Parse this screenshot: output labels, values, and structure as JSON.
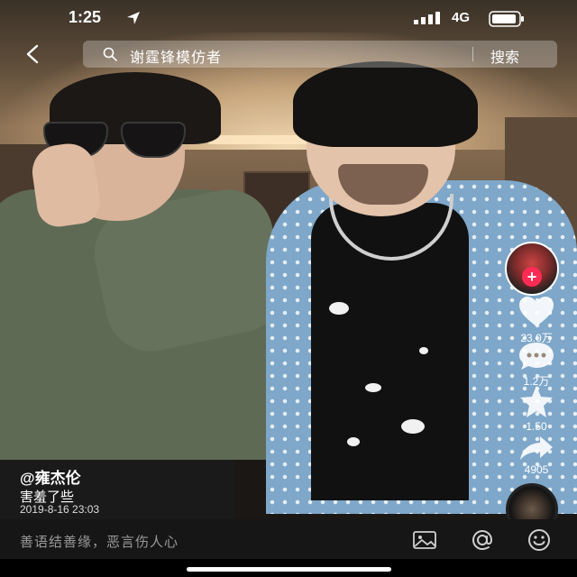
{
  "status_bar": {
    "time": "1:25",
    "network": "4G"
  },
  "header": {
    "search_query": "谢霆锋模仿者",
    "search_button": "搜索"
  },
  "actions": {
    "likes": "23.0万",
    "comments": "1.2万",
    "favorites": "1.50",
    "shares": "4905",
    "follow_symbol": "+"
  },
  "video": {
    "author": "@雍杰伦",
    "caption": "害羞了些",
    "date": "2019-8-16 23:03"
  },
  "comment_bar": {
    "placeholder": "善语结善缘，恶言伤人心"
  },
  "colors": {
    "accent": "#fe2c55",
    "comment_bar_bg": "#161616"
  }
}
